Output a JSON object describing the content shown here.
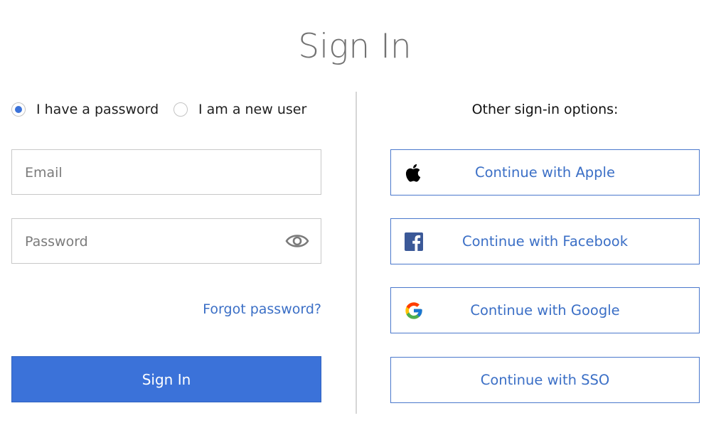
{
  "page": {
    "title": "Sign In"
  },
  "mode": {
    "options": [
      {
        "label": "I have a password",
        "selected": true
      },
      {
        "label": "I am a new user",
        "selected": false
      }
    ]
  },
  "form": {
    "email": {
      "placeholder": "Email",
      "value": ""
    },
    "password": {
      "placeholder": "Password",
      "value": "",
      "toggle_icon": "eye-icon"
    },
    "forgot_label": "Forgot password?",
    "submit_label": "Sign In"
  },
  "other": {
    "heading": "Other sign-in options:",
    "providers": [
      {
        "label": "Continue with Apple",
        "icon": "apple-icon"
      },
      {
        "label": "Continue with Facebook",
        "icon": "facebook-icon"
      },
      {
        "label": "Continue with Google",
        "icon": "google-icon"
      },
      {
        "label": "Continue with SSO",
        "icon": ""
      }
    ]
  },
  "colors": {
    "accent": "#3b72d9",
    "link": "#3b6fc6",
    "facebook": "#3b5998",
    "title": "#727272"
  }
}
